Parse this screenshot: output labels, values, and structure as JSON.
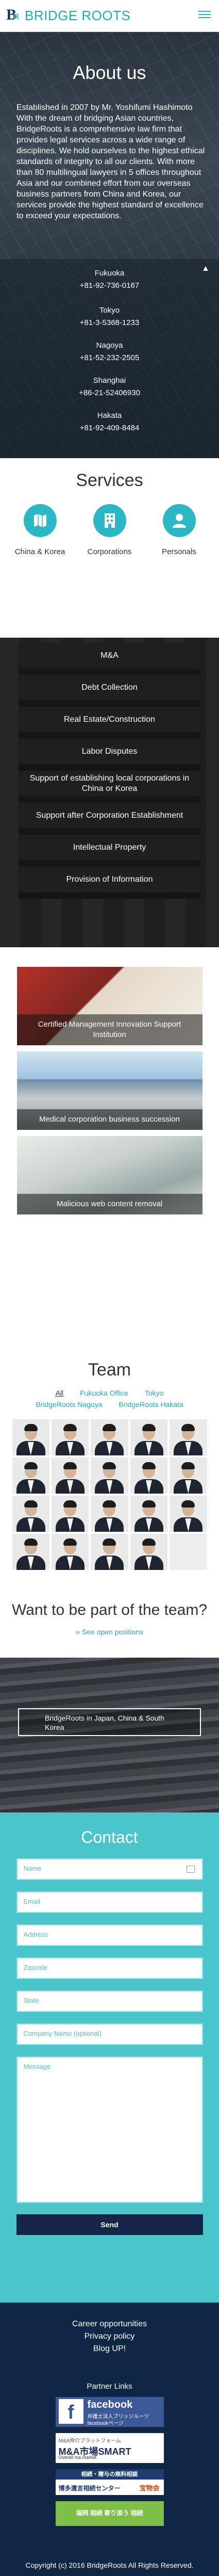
{
  "header": {
    "brand_mark": "B",
    "brand_mark_sub": "R",
    "brand": "BRIDGE ROOTS",
    "colors": {
      "accent": "#29b6c9",
      "navy": "#1d3a5b"
    }
  },
  "about": {
    "title": "About us",
    "intro": "Established in 2007 by Mr. Yoshifumi Hashimoto With the dream of bridging Asian countries, BridgeRoots is a comprehensive law firm that provides legal services across a wide range of disciplines. We hold ourselves to the highest ethical standards of integrity to all our clients. With more than 80 multilingual lawyers in 5 offices throughout Asia and our combined effort from our overseas business partners from China and Korea, our services provide the highest standard of excellence to exceed your expectations.",
    "offices": [
      {
        "city": "Fukuoka",
        "phone": "+81-92-736-0167"
      },
      {
        "city": "Tokyo",
        "phone": "+81-3-5368-1233"
      },
      {
        "city": "Nagoya",
        "phone": "+81-52-232-2505"
      },
      {
        "city": "Shanghai",
        "phone": "+86-21-52406930"
      },
      {
        "city": "Hakata",
        "phone": "+81-92-409-8484"
      }
    ]
  },
  "services": {
    "title": "Services",
    "items": [
      {
        "label": "China & Korea",
        "icon": "map-icon"
      },
      {
        "label": "Corporations",
        "icon": "building-icon"
      },
      {
        "label": "Personals",
        "icon": "person-icon"
      }
    ]
  },
  "practice": [
    "M&A",
    "Debt Collection",
    "Real Estate/Construction",
    "Labor Disputes",
    "Support of establishing local corporations in China or Korea",
    "Support after Corporation Establishment",
    "Intellectual Property",
    "Provision of Information"
  ],
  "topics": [
    "Certified Management Innovation Support Institution",
    "Medical corporation business succession",
    "Malicious web content removal"
  ],
  "team": {
    "title": "Team",
    "filters": [
      "All",
      "Fukuoka Office",
      "Tokyo",
      "BridgeRoots Nagoya",
      "BridgeRoots Hakata"
    ],
    "join_title": "Want to be part of the team?",
    "openings_link": "» See open positions"
  },
  "cta": {
    "label": "BridgeRoots in Japan, China & South Korea"
  },
  "contact": {
    "title": "Contact",
    "fields": [
      "Name",
      "Email",
      "Address",
      "Zipcode",
      "State",
      "Company Name (optional)"
    ],
    "message_placeholder": "Message",
    "send_label": "Send"
  },
  "footer": {
    "links": [
      "Career opportunities",
      "Privacy policy",
      "Blog UP!"
    ],
    "partner_title": "Partner Links",
    "banners": {
      "fb_title": "facebook",
      "fb_sub1": "弁護士法人ブリッジルーツ",
      "fb_sub2": "facebookページ",
      "smart_top": "M&A仲介プラットフォーム",
      "smart_title": "M&A市場SMART",
      "smart_sub": "Overall ma market",
      "jp_top": "相続・贈与の無料相談",
      "jp_left": "博多遺言相続センター",
      "jp_right": "宝物会",
      "green_text": "福岡 相続 寄り添う 相続"
    },
    "copyright": "Copyright (c) 2016 BridgeRoots All Rights Reserved."
  }
}
